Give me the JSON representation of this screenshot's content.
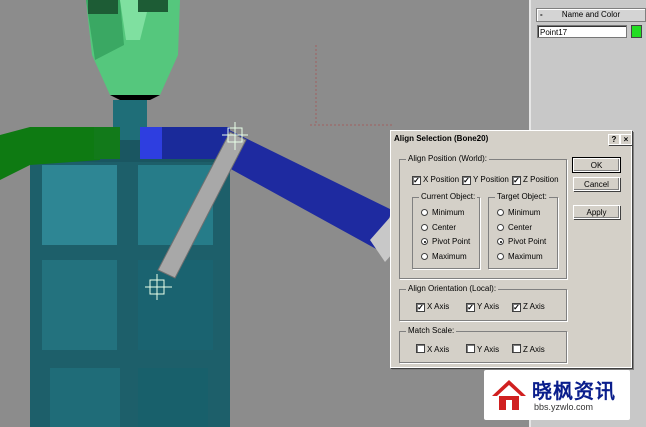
{
  "command_panel": {
    "rollout_label": "Name and Color",
    "rollout_toggle": "-",
    "object_name": "Point17",
    "object_color": "#22dd22"
  },
  "dialog": {
    "title": "Align Selection (Bone20)",
    "help_button": "?",
    "close_button": "×",
    "align_position": {
      "label": "Align Position (World):",
      "x": {
        "label": "X Position",
        "checked": true
      },
      "y": {
        "label": "Y Position",
        "checked": true
      },
      "z": {
        "label": "Z Position",
        "checked": true
      }
    },
    "current_object": {
      "label": "Current Object:",
      "options": [
        "Minimum",
        "Center",
        "Pivot Point",
        "Maximum"
      ],
      "selected": "Pivot Point"
    },
    "target_object": {
      "label": "Target Object:",
      "options": [
        "Minimum",
        "Center",
        "Pivot Point",
        "Maximum"
      ],
      "selected": "Pivot Point"
    },
    "align_orientation": {
      "label": "Align Orientation (Local):",
      "x": {
        "label": "X Axis",
        "checked": true
      },
      "y": {
        "label": "Y Axis",
        "checked": true
      },
      "z": {
        "label": "Z Axis",
        "checked": true
      }
    },
    "match_scale": {
      "label": "Match Scale:",
      "x": {
        "label": "X Axis",
        "checked": false
      },
      "y": {
        "label": "Y Axis",
        "checked": false
      },
      "z": {
        "label": "Z Axis",
        "checked": false
      }
    },
    "buttons": {
      "ok": "OK",
      "cancel": "Cancel",
      "apply": "Apply"
    }
  },
  "watermark": {
    "brand": "晓枫资讯",
    "url": "bbs.yzwlo.com"
  },
  "icons": [
    "viewport-character-model",
    "point-helper-icon",
    "logo-house-icon"
  ]
}
